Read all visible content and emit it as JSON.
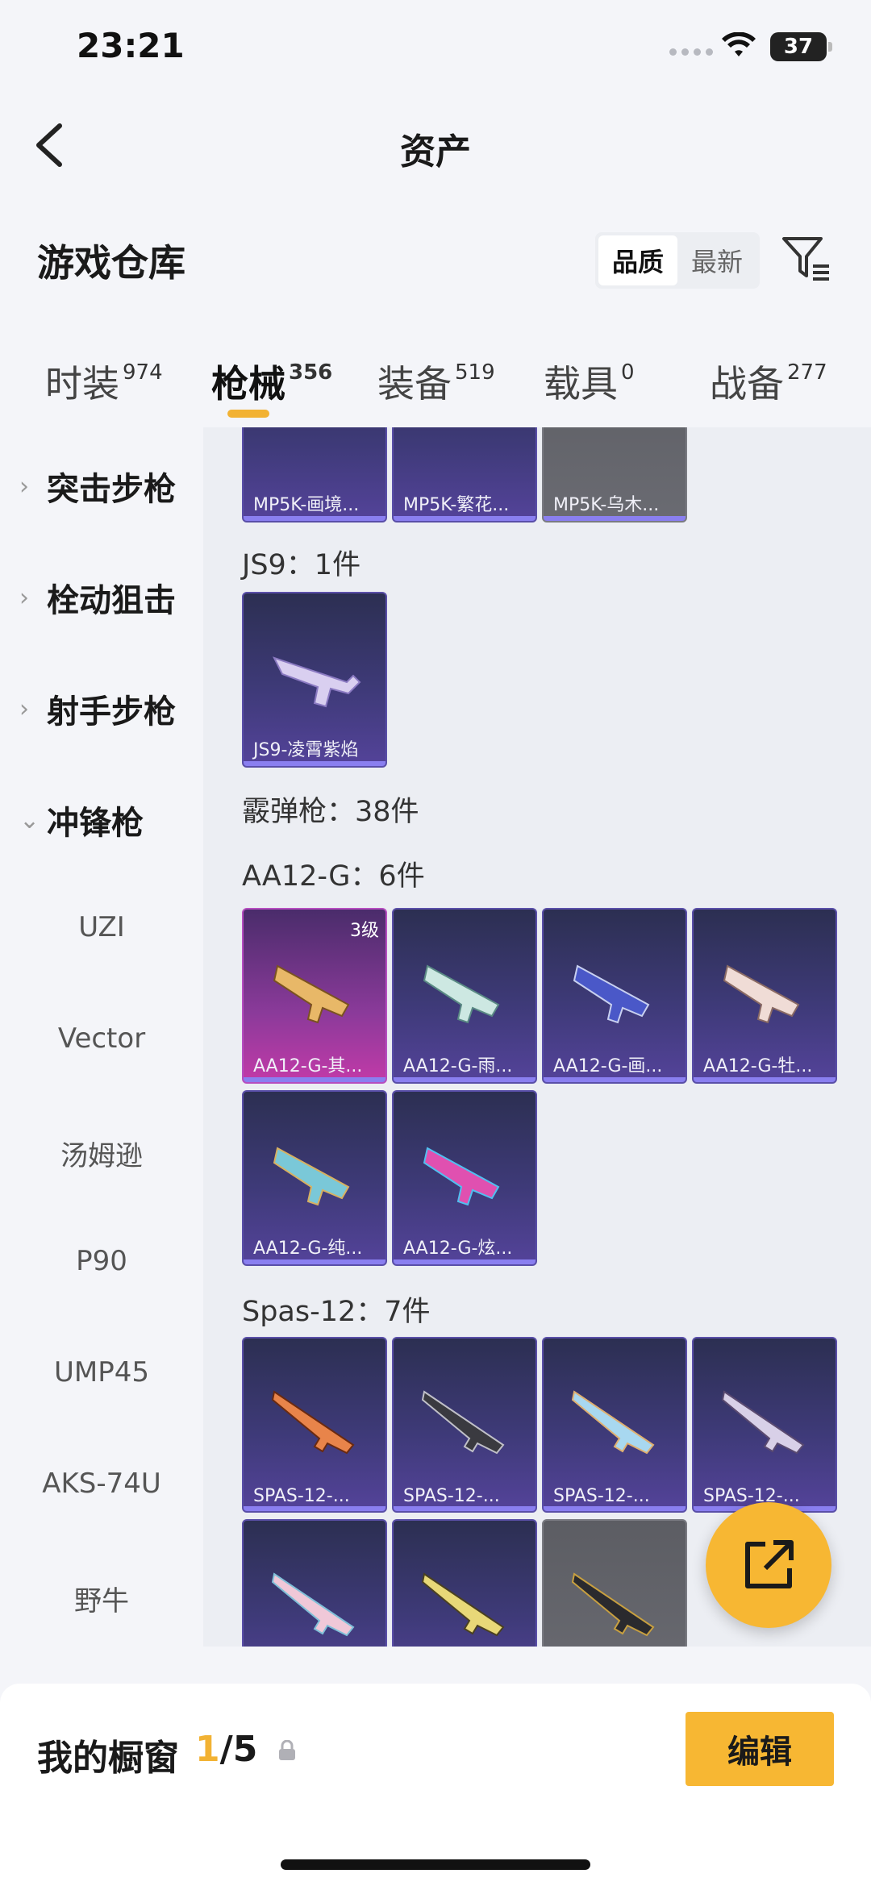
{
  "status": {
    "time": "23:21",
    "battery": "37"
  },
  "nav": {
    "title": "资产"
  },
  "header": {
    "title": "游戏仓库",
    "sort": [
      "品质",
      "最新"
    ]
  },
  "tabs": [
    {
      "label": "时装",
      "count": "974"
    },
    {
      "label": "枪械",
      "count": "356"
    },
    {
      "label": "装备",
      "count": "519"
    },
    {
      "label": "载具",
      "count": "0"
    },
    {
      "label": "战备",
      "count": "277"
    }
  ],
  "sidebar": {
    "categories": [
      "突击步枪",
      "栓动狙击",
      "射手步枪",
      "冲锋枪"
    ],
    "subcategories": [
      "UZI",
      "Vector",
      "汤姆逊",
      "P90",
      "UMP45",
      "AKS-74U",
      "野牛"
    ]
  },
  "content": {
    "top_row": [
      "MP5K-画境...",
      "MP5K-繁花...",
      "MP5K-乌木..."
    ],
    "groups": {
      "js9": {
        "label": "JS9：1件",
        "items": [
          "JS9-凌霄紫焰"
        ]
      },
      "shotgun": {
        "label": "霰弹枪：38件"
      },
      "aa12": {
        "label": "AA12-G：6件",
        "level": "3级",
        "items": [
          "AA12-G-其...",
          "AA12-G-雨...",
          "AA12-G-画...",
          "AA12-G-牡...",
          "AA12-G-纯...",
          "AA12-G-炫..."
        ]
      },
      "spas": {
        "label": "Spas-12：7件",
        "items": [
          "SPAS-12-...",
          "SPAS-12-...",
          "SPAS-12-...",
          "SPAS-12-..."
        ]
      }
    }
  },
  "showcase": {
    "label": "我的橱窗",
    "current": "1",
    "total": "/5",
    "edit_label": "编辑"
  },
  "colors": {
    "accent": "#f7b733",
    "card_purple": "#3e3a78",
    "card_grey": "#6a6b72"
  }
}
